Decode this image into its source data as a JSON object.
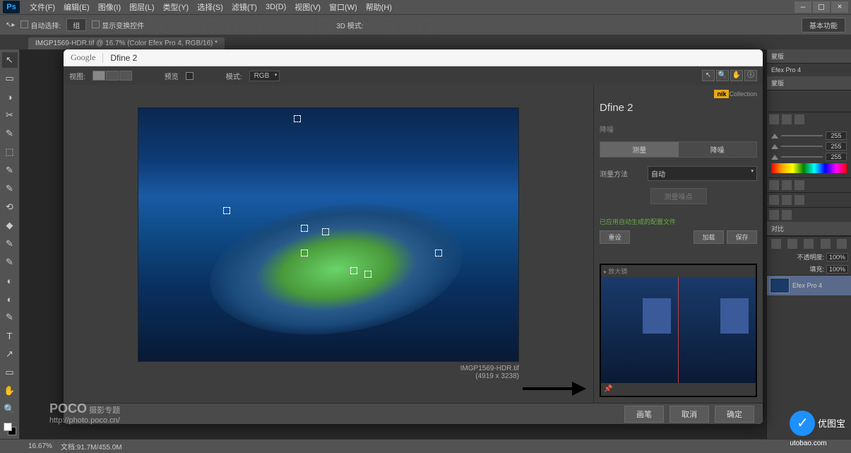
{
  "app": {
    "logo": "Ps",
    "menu": [
      "文件(F)",
      "编辑(E)",
      "图像(I)",
      "图层(L)",
      "类型(Y)",
      "选择(S)",
      "滤镜(T)",
      "3D(D)",
      "视图(V)",
      "窗口(W)",
      "帮助(H)"
    ]
  },
  "options": {
    "auto_select": "自动选择:",
    "group": "组",
    "show_transform": "显示变换控件",
    "mode3d": "3D 模式:",
    "workspace": "基本功能"
  },
  "doctab": "IMGP1569-HDR.tif @ 16.7% (Color Efex Pro 4, RGB/16) *",
  "tools": [
    "↖",
    "▭",
    "◑",
    "✂",
    "✎",
    "⬚",
    "✎",
    "✎",
    "⟲",
    "◆",
    "✎",
    "◐",
    "T",
    "↗",
    "✋",
    "🔍"
  ],
  "right": {
    "panel1": "蒙版",
    "panel1b": "Efex Pro 4",
    "panel2": "蒙版",
    "rgb_value": "255",
    "layers_title": "对比",
    "opacity_label": "不透明度:",
    "opacity_value": "100%",
    "fill_label": "填充:",
    "fill_value": "100%",
    "layer_name": "Efex Pro 4"
  },
  "dfine": {
    "google": "Google",
    "title": "Dfine 2",
    "toolbar": {
      "view_label": "视图:",
      "preview_label": "预览",
      "mode_label": "模式:",
      "mode_value": "RGB"
    },
    "preview_tools": [
      "↖",
      "🔍",
      "✋",
      "ⓘ"
    ],
    "preview": {
      "filename": "IMGP1569-HDR.tif",
      "dims": "(4919 x 3238)"
    },
    "side": {
      "brand_tag": "nik",
      "brand_suffix": "Collection",
      "title": "Dfine 2",
      "section": "降噪",
      "tab1": "测量",
      "tab2": "降噪",
      "method_label": "测量方法",
      "method_value": "自动",
      "measure_btn": "测量噪点",
      "status": "已应用自动生成的配置文件",
      "btn_reset": "重设",
      "btn_load": "加载",
      "btn_save": "保存",
      "loupe_title": "放大镜"
    },
    "footer": {
      "brush": "画笔",
      "cancel": "取消",
      "ok": "确定"
    }
  },
  "status": {
    "zoom": "16.67%",
    "docinfo": "文档:91.7M/455.0M"
  },
  "watermark": {
    "brand": "POCO",
    "sub": "摄影专题",
    "url": "http://photo.poco.cn/",
    "site_icon": "✓",
    "site1": "优图宝",
    "site2": "utobao.com"
  }
}
